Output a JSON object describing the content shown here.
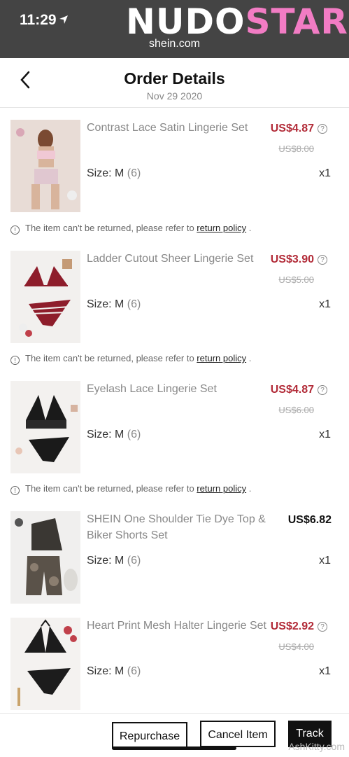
{
  "status": {
    "time": "11:29",
    "watermark_a": "NUDO",
    "watermark_b": "STAR",
    "url": "shein.com"
  },
  "header": {
    "title": "Order Details",
    "date": "Nov 29 2020"
  },
  "items": [
    {
      "name": "Contrast Lace Satin Lingerie Set",
      "price": "US$4.87",
      "original_price": "US$8.00",
      "size_label": "Size: M",
      "size_num": "(6)",
      "qty": "x1",
      "notice": "The item can't be returned, please refer to",
      "notice_link": "return policy",
      "notice_end": "."
    },
    {
      "name": "Ladder Cutout Sheer Lingerie Set",
      "price": "US$3.90",
      "original_price": "US$5.00",
      "size_label": "Size: M",
      "size_num": "(6)",
      "qty": "x1",
      "notice": "The item can't be returned, please refer to",
      "notice_link": "return policy",
      "notice_end": "."
    },
    {
      "name": "Eyelash Lace Lingerie Set",
      "price": "US$4.87",
      "original_price": "US$6.00",
      "size_label": "Size: M",
      "size_num": "(6)",
      "qty": "x1",
      "notice": "The item can't be returned, please refer to",
      "notice_link": "return policy",
      "notice_end": "."
    },
    {
      "name": "SHEIN One Shoulder Tie Dye Top & Biker Shorts Set",
      "price": "US$6.82",
      "size_label": "Size: M",
      "size_num": "(6)",
      "qty": "x1"
    },
    {
      "name": "Heart Print Mesh Halter Lingerie Set",
      "price": "US$2.92",
      "original_price": "US$4.00",
      "size_label": "Size: M",
      "size_num": "(6)",
      "qty": "x1"
    }
  ],
  "actions": {
    "repurchase": "Repurchase",
    "cancel": "Cancel Item",
    "track": "Track"
  },
  "site_mark": "AshKitty.com",
  "colors": {
    "sale_price": "#b22b38",
    "primary": "#111111"
  }
}
